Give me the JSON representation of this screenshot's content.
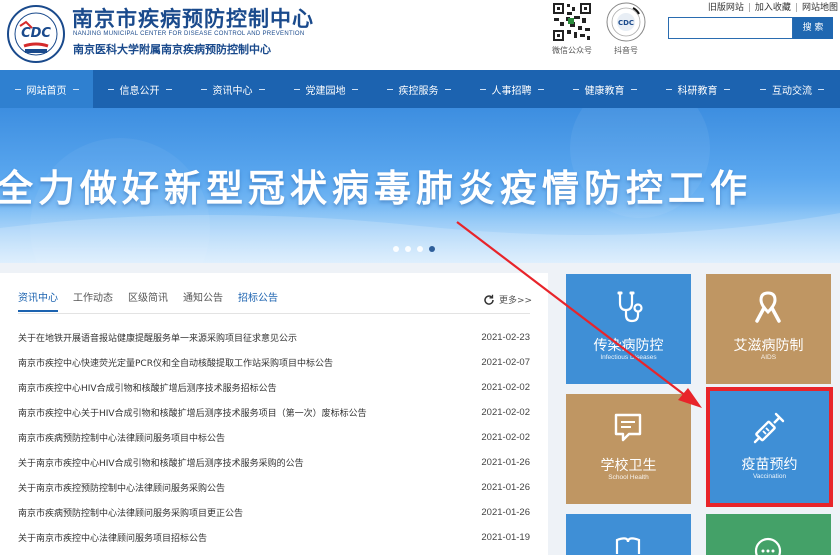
{
  "header": {
    "org_name_cn": "南京市疾病预防控制中心",
    "org_name_en": "NANJING MUNICIPAL CENTER FOR DISEASE CONTROL AND PREVENTION",
    "org_subtitle": "南京医科大学附属南京疾病预防控制中心",
    "qr_wechat_label": "微信公众号",
    "qr_douyin_label": "抖音号",
    "top_links": [
      "旧版网站",
      "加入收藏",
      "网站地图"
    ],
    "search": {
      "value": "",
      "button_label": "搜 索"
    }
  },
  "nav": {
    "items": [
      {
        "label": "网站首页",
        "active": true
      },
      {
        "label": "信息公开"
      },
      {
        "label": "资讯中心"
      },
      {
        "label": "党建园地"
      },
      {
        "label": "疾控服务"
      },
      {
        "label": "人事招聘"
      },
      {
        "label": "健康教育"
      },
      {
        "label": "科研教育"
      },
      {
        "label": "互动交流"
      }
    ]
  },
  "banner": {
    "headline": "全力做好新型冠状病毒肺炎疫情防控工作",
    "slide_count": 4,
    "active_slide": 4
  },
  "news": {
    "tabs": [
      "资讯中心",
      "工作动态",
      "区级简讯",
      "通知公告",
      "招标公告"
    ],
    "active_tab": "资讯中心",
    "more_label": "更多>>",
    "rows": [
      {
        "title": "关于在地铁开展语音报站健康提醒服务单一来源采购项目征求意见公示",
        "date": "2021-02-23"
      },
      {
        "title": "南京市疾控中心快速荧光定量PCR仪和全自动核酸提取工作站采购项目中标公告",
        "date": "2021-02-07"
      },
      {
        "title": "南京市疾控中心HIV合成引物和核酸扩增后测序技术服务招标公告",
        "date": "2021-02-02"
      },
      {
        "title": "南京市疾控中心关于HIV合成引物和核酸扩增后测序技术服务项目（第一次）废标标公告",
        "date": "2021-02-02"
      },
      {
        "title": "南京市疾病预防控制中心法律顾问服务项目中标公告",
        "date": "2021-02-02"
      },
      {
        "title": "关于南京市疾控中心HIV合成引物和核酸扩增后测序技术服务采购的公告",
        "date": "2021-01-26"
      },
      {
        "title": "关于南京市疾控预防控制中心法律顾问服务采购公告",
        "date": "2021-01-26"
      },
      {
        "title": "南京市疾病预防控制中心法律顾问服务采购项目更正公告",
        "date": "2021-01-26"
      },
      {
        "title": "关于南京市疾控中心法律顾问服务项目招标公告",
        "date": "2021-01-19"
      }
    ]
  },
  "services": [
    {
      "name": "传染病防控",
      "sub": "Infectious Diseases",
      "color": "#3f8fd6",
      "icon": "stethoscope-icon"
    },
    {
      "name": "艾滋病防制",
      "sub": "AIDS",
      "color": "#bf9663",
      "icon": "ribbon-icon"
    },
    {
      "name": "学校卫生",
      "sub": "School Health",
      "color": "#bf9663",
      "icon": "chat-doc-icon"
    },
    {
      "name": "疫苗预约",
      "sub": "Vaccination",
      "color": "#3f8fd6",
      "icon": "syringe-icon",
      "highlighted": true
    }
  ]
}
